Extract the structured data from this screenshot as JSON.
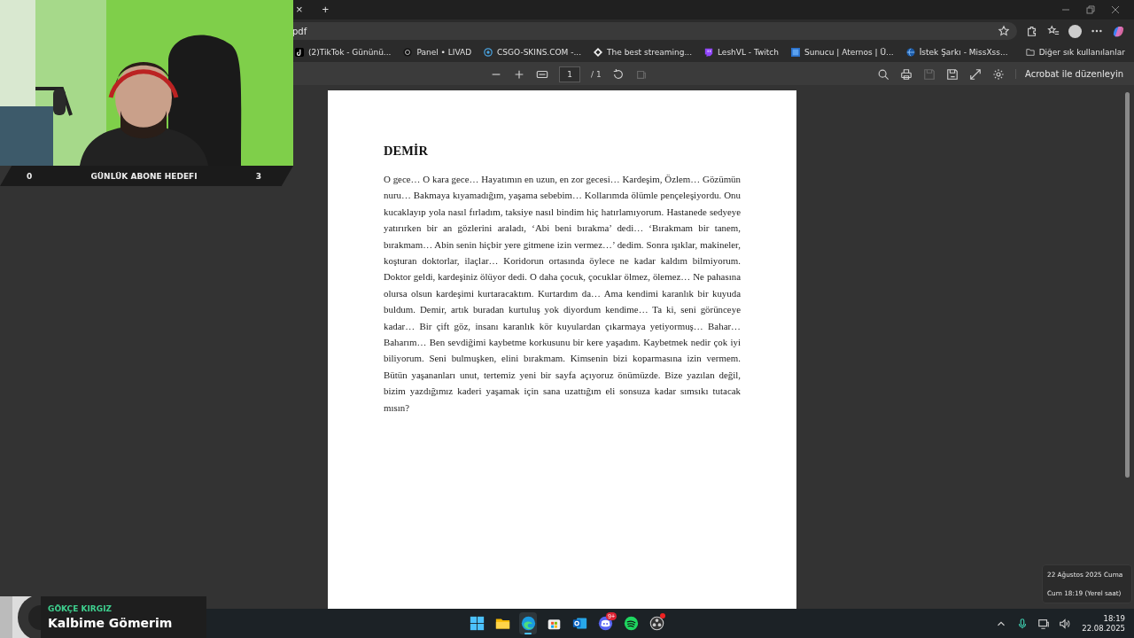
{
  "browser": {
    "tab_strip": {
      "close": "×",
      "new_tab": "+"
    },
    "address_bar": {
      "value": "pdf"
    },
    "bookmarks": [
      {
        "label": "(2)TikTok - Gününü...",
        "kind": "tiktok"
      },
      {
        "label": "Panel • LIVAD",
        "kind": "panel"
      },
      {
        "label": "CSGO-SKINS.COM -...",
        "kind": "target"
      },
      {
        "label": "The best streaming...",
        "kind": "diamond"
      },
      {
        "label": "LeshVL - Twitch",
        "kind": "twitch"
      },
      {
        "label": "Sunucu | Aternos | Ü...",
        "kind": "square"
      },
      {
        "label": "İstek Şarkı - MissXss...",
        "kind": "globe"
      }
    ],
    "other_favorites": "Diğer sık kullanılanlar",
    "pdf_toolbar": {
      "page": "1",
      "page_total": "/ 1",
      "edit_button": "Acrobat ile düzenleyin"
    },
    "document": {
      "title": "DEMİR",
      "body": "O gece… O kara gece… Hayatımın en uzun, en zor gecesi… Kardeşim, Özlem… Gözümün nuru… Bakmaya kıyamadığım, yaşama sebebim… Kollarımda ölümle pençeleşiyordu. Onu kucaklayıp yola nasıl fırladım, taksiye nasıl bindim hiç hatırlamıyorum. Hastanede sedyeye yatırırken bir an gözlerini araladı, ‘Abi beni bırakma’ dedi… ‘Bırakmam bir tanem, bırakmam… Abin senin hiçbir yere gitmene izin vermez…’ dedim. Sonra ışıklar, makineler, koşturan doktorlar, ilaçlar… Koridorun ortasında öylece ne kadar kaldım bilmiyorum. Doktor geldi, kardeşiniz ölüyor dedi. O daha çocuk, çocuklar ölmez, ölemez… Ne pahasına olursa olsun kardeşimi kurtaracaktım. Kurtardım da… Ama kendimi karanlık bir kuyuda buldum. Demir, artık buradan kurtuluş yok diyordum kendime… Ta ki, seni görünceye kadar… Bir çift göz, insanı karanlık kör kuyulardan çıkarmaya yetiyormuş… Bahar… Baharım… Ben sevdiğimi kaybetme korkusunu bir kere yaşadım. Kaybetmek nedir çok iyi biliyorum. Seni bulmuşken, elini bırakmam. Kimsenin bizi koparmasına izin vermem. Bütün yaşananları unut, tertemiz yeni bir sayfa açıyoruz önümüzde. Bize yazılan değil, bizim yazdığımız kaderi yaşamak için sana uzattığım eli sonsuza kadar sımsıkı tutacak mısın?"
    }
  },
  "stream_overlay": {
    "sub_goal": {
      "current": "0",
      "label": "GÜNLÜK ABONE HEDEFI",
      "target": "3"
    },
    "now_playing": {
      "artist": "GÖKÇE KIRGIZ",
      "title": "Kalbime Gömerim"
    }
  },
  "taskbar": {
    "apps": [
      {
        "kind": "start",
        "selected": false,
        "alert": false
      },
      {
        "kind": "folder",
        "selected": false,
        "alert": false
      },
      {
        "kind": "edge",
        "selected": true,
        "alert": false
      },
      {
        "kind": "store",
        "selected": false,
        "alert": false
      },
      {
        "kind": "outlook",
        "selected": false,
        "alert": false
      },
      {
        "kind": "discord",
        "badge": "9+",
        "selected": false,
        "alert": false
      },
      {
        "kind": "spotify",
        "selected": false,
        "alert": false
      },
      {
        "kind": "obs",
        "selected": false,
        "alert": true
      }
    ],
    "clock": {
      "time": "18:19",
      "date": "22.08.2025"
    },
    "tooltip": {
      "date": "22 Ağustos 2025 Cuma",
      "time": "Cum 18:19 (Yerel saat)"
    }
  }
}
